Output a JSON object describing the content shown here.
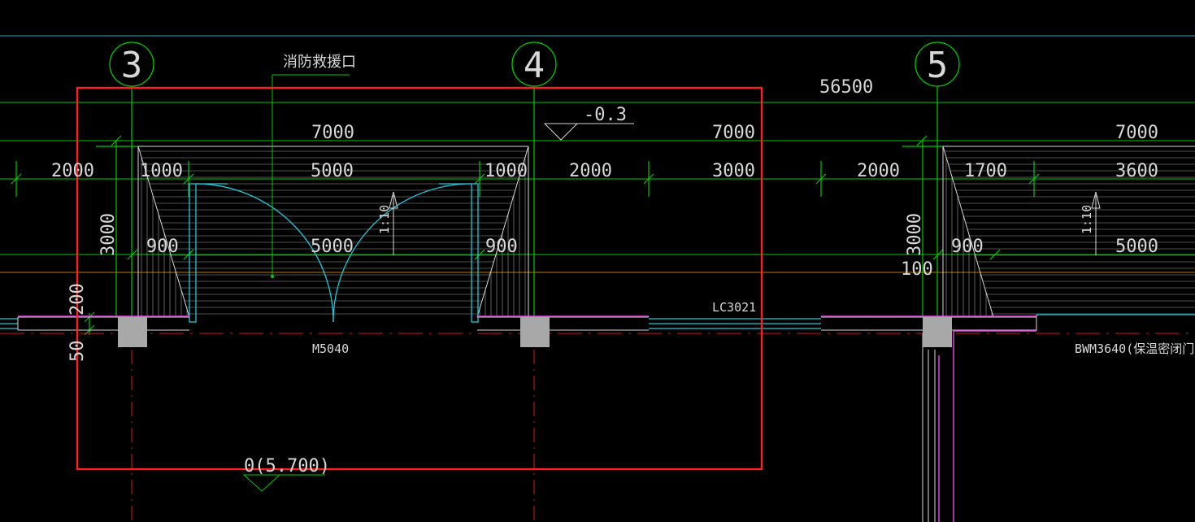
{
  "canvas": {
    "background": "#000000"
  },
  "colors": {
    "dim_line": "#00cc00",
    "dim_text": "#d8d8d8",
    "selection_frame": "#ff2020",
    "cyan": "#20c8d8",
    "magenta": "#e040e0",
    "orange": "#c07800",
    "hatch": "#a0a0a0",
    "column": "#a8a8a8",
    "teal_top": "#00b8b8",
    "red_axis": "#d01818"
  },
  "axes": [
    {
      "id": "axis-3",
      "label": "3"
    },
    {
      "id": "axis-4",
      "label": "4"
    },
    {
      "id": "axis-5",
      "label": "5"
    }
  ],
  "annotations": {
    "fire_rescue": "消防救援口",
    "total_dim": "56500",
    "elev_top": "-0.3",
    "elev_bottom": "0(5.700)",
    "door_m5040": "M5040",
    "window_lc3021": "LC3021",
    "door_bwm": "BWM3640(保温密闭门"
  },
  "dimensions": {
    "row1": [
      "7000",
      "7000",
      "7000"
    ],
    "row2": [
      "2000",
      "1000",
      "5000",
      "1000",
      "2000",
      "3000",
      "2000",
      "1700",
      "3600"
    ],
    "row3": [
      "900",
      "5000",
      "900",
      "900",
      "5000"
    ],
    "vertical": [
      "3000",
      "200",
      "50",
      "3000",
      "100"
    ],
    "slope": [
      "1:10",
      "1:10"
    ]
  }
}
